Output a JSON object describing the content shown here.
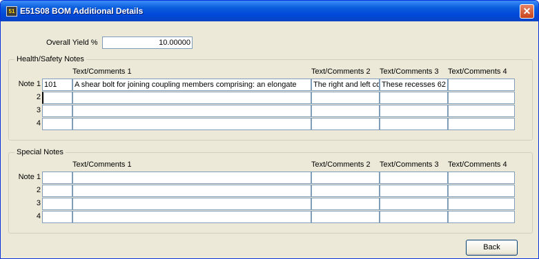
{
  "window": {
    "title": "E51S08  BOM Additional Details",
    "app_icon_glyph": "51",
    "close_glyph": "✕"
  },
  "overall_yield": {
    "label": "Overall Yield %",
    "value": "10.00000"
  },
  "health_safety": {
    "title": "Health/Safety Notes",
    "col_headers": [
      "Text/Comments 1",
      "Text/Comments 2",
      "Text/Comments 3",
      "Text/Comments 4"
    ],
    "rows": [
      {
        "label": "Note 1",
        "code": "101",
        "texts": [
          "A shear bolt for joining coupling members comprising: an elongate",
          "The right and left co",
          "These recesses 62",
          ""
        ]
      },
      {
        "label": "2",
        "code": "",
        "texts": [
          "",
          "",
          "",
          ""
        ]
      },
      {
        "label": "3",
        "code": "",
        "texts": [
          "",
          "",
          "",
          ""
        ]
      },
      {
        "label": "4",
        "code": "",
        "texts": [
          "",
          "",
          "",
          ""
        ]
      }
    ]
  },
  "special": {
    "title": "Special Notes",
    "col_headers": [
      "Text/Comments 1",
      "Text/Comments 2",
      "Text/Comments 3",
      "Text/Comments 4"
    ],
    "rows": [
      {
        "label": "Note 1",
        "code": "",
        "texts": [
          "",
          "",
          "",
          ""
        ]
      },
      {
        "label": "2",
        "code": "",
        "texts": [
          "",
          "",
          "",
          ""
        ]
      },
      {
        "label": "3",
        "code": "",
        "texts": [
          "",
          "",
          "",
          ""
        ]
      },
      {
        "label": "4",
        "code": "",
        "texts": [
          "",
          "",
          "",
          ""
        ]
      }
    ]
  },
  "buttons": {
    "back": "Back"
  },
  "colors": {
    "titlebar": "#0148d8",
    "face": "#ece9d8",
    "field_border": "#7f9db9",
    "close": "#c8441a"
  }
}
